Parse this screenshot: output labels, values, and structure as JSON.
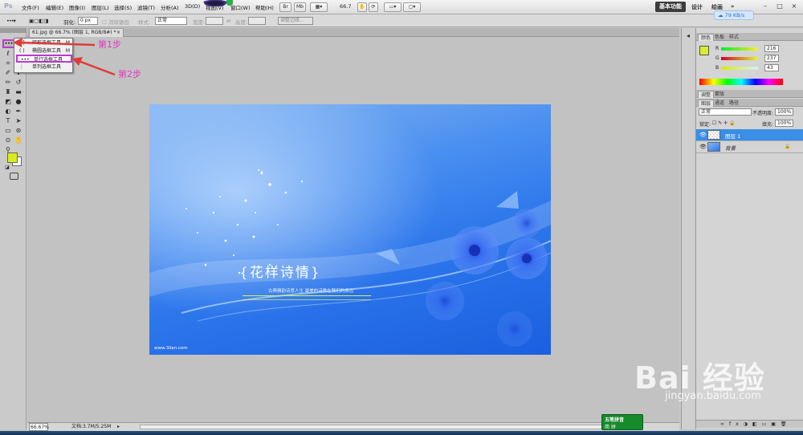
{
  "menubar": {
    "logo": "Ps",
    "items": [
      "文件(F)",
      "编辑(E)",
      "图像(I)",
      "图层(L)",
      "选择(S)",
      "滤镜(T)",
      "分析(A)",
      "3D(D)",
      "视图(V)",
      "窗口(W)",
      "帮助(H)"
    ],
    "zoom": "66.7",
    "workspace_active": "基本功能",
    "workspace_design": "设计",
    "workspace_paint": "绘画",
    "more": "»",
    "network_speed": "79 KB/s",
    "minimize": "–",
    "restore": "□",
    "close": "×"
  },
  "options": {
    "feather_label": "羽化:",
    "feather_value": "0 px",
    "antialias_label": "消除锯齿",
    "style_label": "样式:",
    "style_value": "正常",
    "width_label": "宽度:",
    "height_label": "高度:",
    "refine_edge": "调整边缘..."
  },
  "document": {
    "tab_title": "61.jpg @ 66.7% (图层 1, RGB/8#) *",
    "tab_close": "×"
  },
  "flyout": {
    "items": [
      {
        "icon": "[ ]",
        "label": "矩形选框工具",
        "key": "M"
      },
      {
        "icon": "( )",
        "label": "椭圆选框工具",
        "key": "M"
      },
      {
        "icon": "•••",
        "label": "单行选框工具",
        "key": ""
      },
      {
        "icon": "⋮",
        "label": "单列选框工具",
        "key": ""
      }
    ]
  },
  "annotations": {
    "step1": "第1步",
    "step2": "第2步"
  },
  "artwork": {
    "title": "{花样诗情}",
    "subtitle": "古典雅韵诗意人生   最美的诗歌在我们的身边",
    "website": "www.3lian.com"
  },
  "status": {
    "zoom": "66.67%",
    "doc_info": "文档:3.7M/5.25M"
  },
  "color_panel": {
    "tabs": [
      "颜色",
      "色板",
      "样式"
    ],
    "r_label": "R",
    "g_label": "G",
    "b_label": "B",
    "r": "216",
    "g": "237",
    "b": "43",
    "swatch_color": "#d8ed2b"
  },
  "adjust_panel": {
    "tabs": [
      "调整",
      "蒙版"
    ]
  },
  "layers_panel": {
    "tabs": [
      "图层",
      "通道",
      "路径"
    ],
    "blend_mode": "正常",
    "opacity_label": "不透明度:",
    "opacity": "100%",
    "lock_label": "锁定:",
    "fill_label": "填充:",
    "fill": "100%",
    "layers": [
      {
        "name": "图层 1",
        "selected": true
      },
      {
        "name": "背景",
        "selected": false
      }
    ]
  },
  "ime": {
    "line1": "五笔拼音",
    "line2": "简 拼"
  },
  "watermark": {
    "brand": "Bai 经验",
    "url": "jingyan.baidu.com"
  },
  "colors": {
    "accent_magenta": "#c236d6",
    "arrow_red": "#e23a3a",
    "foreground": "#d8ec1e",
    "layer_selected": "#3a8ee6"
  }
}
